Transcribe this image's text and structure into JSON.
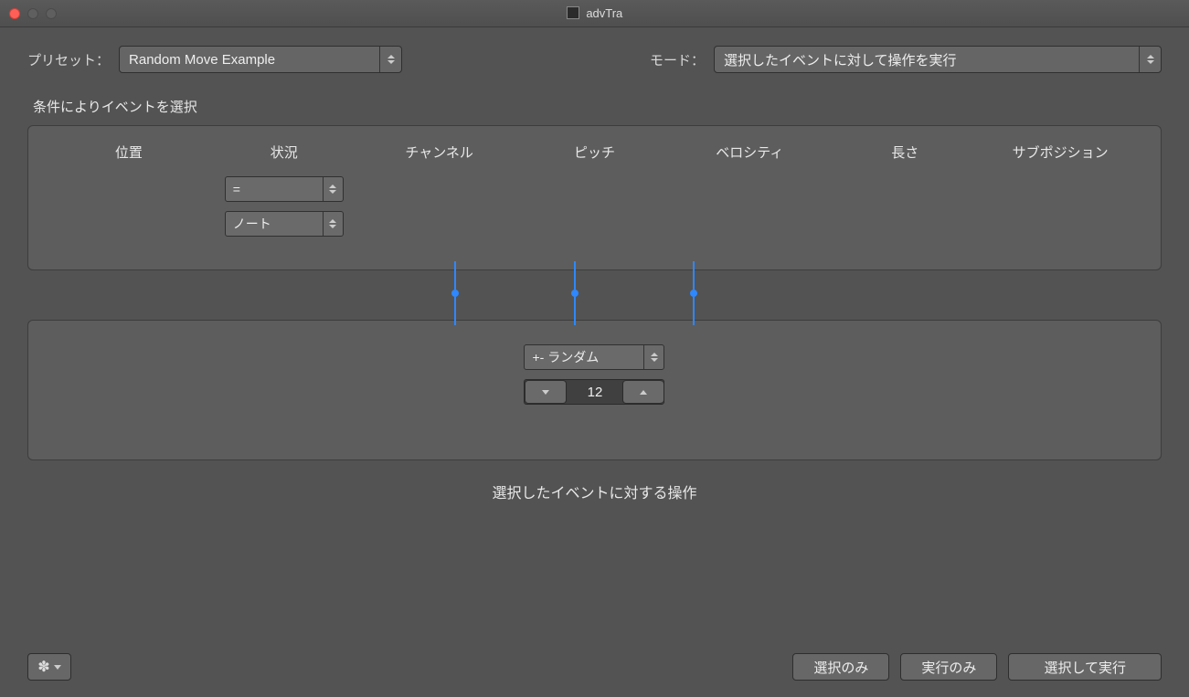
{
  "window": {
    "title": "advTra"
  },
  "header": {
    "preset_label": "プリセット：",
    "preset_value": "Random Move Example",
    "mode_label": "モード：",
    "mode_value": "選択したイベントに対して操作を実行"
  },
  "filter": {
    "section_title": "条件によりイベントを選択",
    "columns": {
      "position": "位置",
      "status": "状況",
      "channel": "チャンネル",
      "pitch": "ピッチ",
      "velocity": "ベロシティ",
      "length": "長さ",
      "subposition": "サブポジション"
    },
    "status_op": "=",
    "status_type": "ノート"
  },
  "action": {
    "pitch_mode": "+- ランダム",
    "pitch_value": "12",
    "section_title": "選択したイベントに対する操作"
  },
  "footer": {
    "select_only": "選択のみ",
    "execute_only": "実行のみ",
    "select_execute": "選択して実行"
  }
}
